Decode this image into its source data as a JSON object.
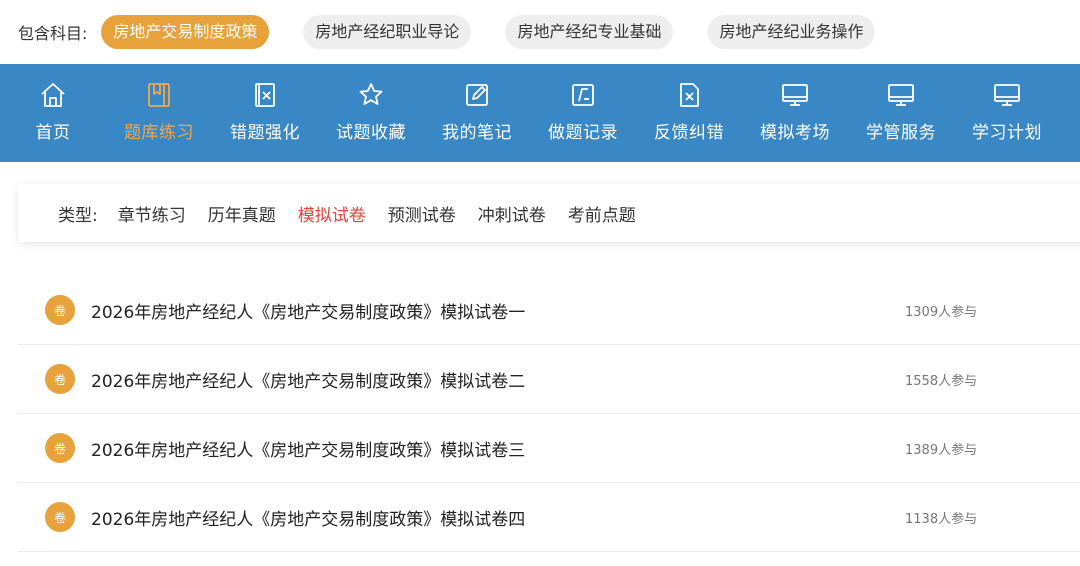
{
  "subjects": {
    "label": "包含科目:",
    "items": [
      {
        "label": "房地产交易制度政策",
        "active": true
      },
      {
        "label": "房地产经纪职业导论",
        "active": false
      },
      {
        "label": "房地产经纪专业基础",
        "active": false
      },
      {
        "label": "房地产经纪业务操作",
        "active": false
      }
    ]
  },
  "nav": {
    "items": [
      {
        "label": "首页",
        "icon": "home-icon"
      },
      {
        "label": "题库练习",
        "icon": "book-icon",
        "active": true
      },
      {
        "label": "错题强化",
        "icon": "wrong-icon"
      },
      {
        "label": "试题收藏",
        "icon": "star-icon"
      },
      {
        "label": "我的笔记",
        "icon": "note-icon"
      },
      {
        "label": "做题记录",
        "icon": "record-icon"
      },
      {
        "label": "反馈纠错",
        "icon": "feedback-icon"
      },
      {
        "label": "模拟考场",
        "icon": "monitor-icon"
      },
      {
        "label": "学管服务",
        "icon": "monitor-icon"
      },
      {
        "label": "学习计划",
        "icon": "monitor-icon"
      }
    ]
  },
  "types": {
    "label": "类型:",
    "items": [
      {
        "label": "章节练习",
        "active": false
      },
      {
        "label": "历年真题",
        "active": false
      },
      {
        "label": "模拟试卷",
        "active": true
      },
      {
        "label": "预测试卷",
        "active": false
      },
      {
        "label": "冲刺试卷",
        "active": false
      },
      {
        "label": "考前点题",
        "active": false
      }
    ]
  },
  "papers": [
    {
      "badge": "卷",
      "title": "2026年房地产经纪人《房地产交易制度政策》模拟试卷一",
      "count": "1309人参与"
    },
    {
      "badge": "卷",
      "title": "2026年房地产经纪人《房地产交易制度政策》模拟试卷二",
      "count": "1558人参与"
    },
    {
      "badge": "卷",
      "title": "2026年房地产经纪人《房地产交易制度政策》模拟试卷三",
      "count": "1389人参与"
    },
    {
      "badge": "卷",
      "title": "2026年房地产经纪人《房地产交易制度政策》模拟试卷四",
      "count": "1138人参与"
    }
  ],
  "colors": {
    "nav_bg": "#3a87c6",
    "accent": "#e8a23c",
    "active_type": "#e0463b"
  }
}
